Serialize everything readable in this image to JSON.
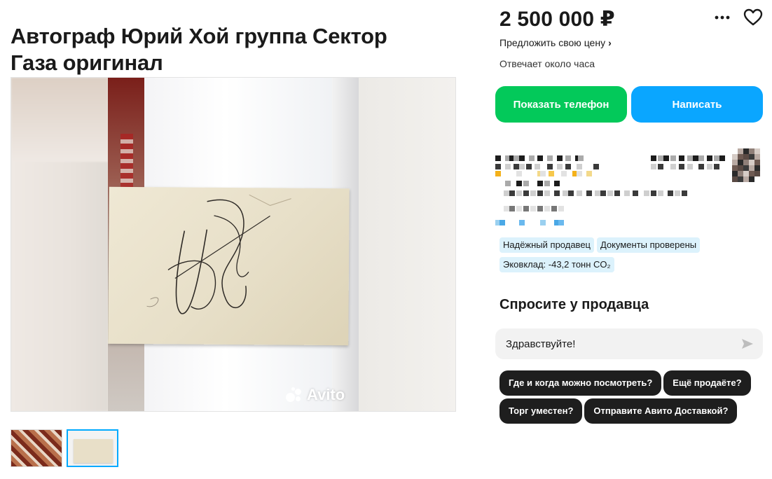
{
  "listing": {
    "title": "Автограф Юрий Хой группа Сектор Газа оригинал",
    "watermark": "Avito"
  },
  "sidebar": {
    "price": "2 500 000 ₽",
    "offer_price_link": "Предложить свою цену",
    "response_time": "Отвечает около часа",
    "show_phone_button": "Показать телефон",
    "write_button": "Написать",
    "badges": [
      "Надёжный продавец",
      "Документы проверены",
      "Эковклад: -43,2 тонн CO₂"
    ],
    "ask_title": "Спросите у продавца",
    "message_value": "Здравствуйте!",
    "quick_questions": [
      "Где и когда можно посмотреть?",
      "Ещё продаёте?",
      "Торг уместен?",
      "Отправите Авито Доставкой?"
    ]
  },
  "icons": {
    "more": "more-dots-icon",
    "favorite": "heart-icon",
    "send": "send-arrow-icon",
    "chevron": "chevron-right-icon"
  },
  "colors": {
    "phone_button": "#03c95a",
    "write_button": "#0aa6ff",
    "badge_bg": "#dcf2fc",
    "chip_bg": "#1e1e1e",
    "thumb_active_border": "#00aaff"
  }
}
